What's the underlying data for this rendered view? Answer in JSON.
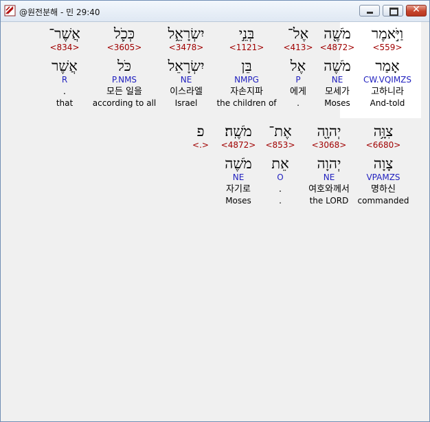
{
  "window": {
    "title": "@원전분해 - 민 29:40",
    "controls": [
      "minimize",
      "maximize",
      "close"
    ]
  },
  "rows": [
    {
      "words": [
        {
          "hebrew": "וַיֹּ֣אמֶר",
          "strong": "<559>",
          "root": "אָמַר",
          "morph": "CW.VQIMZS",
          "korean": "고하니라",
          "english": "And-told",
          "highlighted": true
        },
        {
          "hebrew": "מֹשֶׁ֖ה",
          "strong": "<4872>",
          "root": "מֹשֶׁה",
          "morph": "NE",
          "korean": "모세가",
          "english": "Moses"
        },
        {
          "hebrew": "אֶל־",
          "strong": "<413>",
          "root": "אֶל",
          "morph": "P",
          "korean": "에게",
          "english": "."
        },
        {
          "hebrew": "בְּנֵ֣י",
          "strong": "<1121>",
          "root": "בֵּן",
          "morph": "NMPG",
          "korean": "자손지파",
          "english": "the children of"
        },
        {
          "hebrew": "יִשְׂרָאֵ֑ל",
          "strong": "<3478>",
          "root": "יִשְׂרָאֵל",
          "morph": "NE",
          "korean": "이스라엘",
          "english": "Israel"
        },
        {
          "hebrew": "כְּכֹ֛ל",
          "strong": "<3605>",
          "root": "כֹּל",
          "morph": "P.NMS",
          "korean": "모든 일을",
          "english": "according to all"
        },
        {
          "hebrew": "אֲשֶׁר־",
          "strong": "<834>",
          "root": "אֲשֶׁר",
          "morph": "R",
          "korean": ".",
          "english": "that"
        }
      ]
    },
    {
      "words": [
        {
          "hebrew": "צִוָּ֥ה",
          "strong": "<6680>",
          "root": "צָוָה",
          "morph": "VPAMZS",
          "korean": "명하신",
          "english": "commanded"
        },
        {
          "hebrew": "יְהוָ֖ה",
          "strong": "<3068>",
          "root": "יְהוָה",
          "morph": "NE",
          "korean": "여호와께서",
          "english": "the LORD"
        },
        {
          "hebrew": "אֶת־",
          "strong": "<853>",
          "root": "אֵת",
          "morph": "O",
          "korean": ".",
          "english": "."
        },
        {
          "hebrew": "מֹשֶֽׁה׃",
          "strong": "<4872>",
          "root": "מֹשֶׁה",
          "morph": "NE",
          "korean": "자기로",
          "english": "Moses"
        },
        {
          "hebrew": "פ",
          "strong": "<.>",
          "root": "",
          "morph": "",
          "korean": "",
          "english": ""
        }
      ]
    }
  ],
  "colors": {
    "strong": "#a00000",
    "morph": "#1f1fbf",
    "text": "#000000",
    "highlight": "#ffffff"
  }
}
